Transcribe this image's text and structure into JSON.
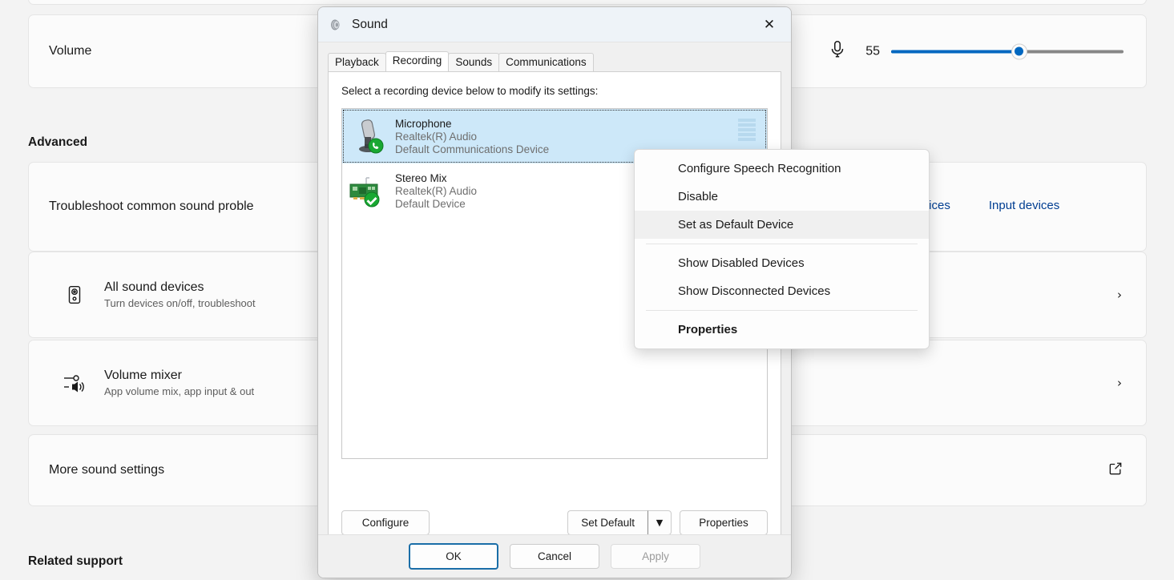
{
  "settings": {
    "volume_card": {
      "label": "Volume",
      "mic_icon": "microphone-icon",
      "value": "55",
      "fill_percent": 55
    },
    "sections": {
      "advanced": "Advanced",
      "related_support": "Related support"
    },
    "device_links": [
      {
        "label": "devices"
      },
      {
        "label": "Input devices"
      }
    ],
    "cards": [
      {
        "title": "Troubleshoot common sound proble",
        "subtitle": "",
        "icon": "",
        "accessory": ""
      },
      {
        "title": "All sound devices",
        "subtitle": "Turn devices on/off, troubleshoot",
        "icon": "speaker-device-icon",
        "accessory": "chevron-right-icon"
      },
      {
        "title": "Volume mixer",
        "subtitle": "App volume mix, app input & out",
        "icon": "volume-mixer-icon",
        "accessory": "chevron-right-icon"
      },
      {
        "title": "More sound settings",
        "subtitle": "",
        "icon": "",
        "accessory": "external-link-icon"
      }
    ]
  },
  "dialog": {
    "title": "Sound",
    "title_icon": "speaker-icon",
    "close_label": "✕",
    "tabs": [
      {
        "label": "Playback",
        "active": false
      },
      {
        "label": "Recording",
        "active": true
      },
      {
        "label": "Sounds",
        "active": false
      },
      {
        "label": "Communications",
        "active": false
      }
    ],
    "hint": "Select a recording device below to modify its settings:",
    "devices": [
      {
        "name": "Microphone",
        "description": "Realtek(R) Audio",
        "state": "Default Communications Device",
        "icon": "microphone-device-icon",
        "badge": "green-phone-badge",
        "selected": true,
        "meter_bars": 5
      },
      {
        "name": "Stereo Mix",
        "description": "Realtek(R) Audio",
        "state": "Default Device",
        "icon": "sound-card-icon",
        "badge": "green-check-badge",
        "selected": false,
        "meter_bars": 0
      }
    ],
    "buttons": {
      "configure": "Configure",
      "set_default": "Set Default",
      "set_default_arrow": "▼",
      "properties": "Properties"
    },
    "footer": {
      "ok": "OK",
      "cancel": "Cancel",
      "apply": "Apply",
      "apply_disabled": true
    }
  },
  "context_menu": {
    "items": [
      {
        "label": "Configure Speech Recognition",
        "hover": false,
        "bold": false,
        "separator_after": false
      },
      {
        "label": "Disable",
        "hover": false,
        "bold": false,
        "separator_after": false
      },
      {
        "label": "Set as Default Device",
        "hover": true,
        "bold": false,
        "separator_after": true
      },
      {
        "label": "Show Disabled Devices",
        "hover": false,
        "bold": false,
        "separator_after": false
      },
      {
        "label": "Show Disconnected Devices",
        "hover": false,
        "bold": false,
        "separator_after": true
      },
      {
        "label": "Properties",
        "hover": false,
        "bold": true,
        "separator_after": false
      }
    ]
  },
  "colors": {
    "accent": "#0067c0",
    "link": "#003e92",
    "selection": "#cde8f9",
    "meter": "#b7d9ee",
    "badge_green": "#1faa3c"
  }
}
